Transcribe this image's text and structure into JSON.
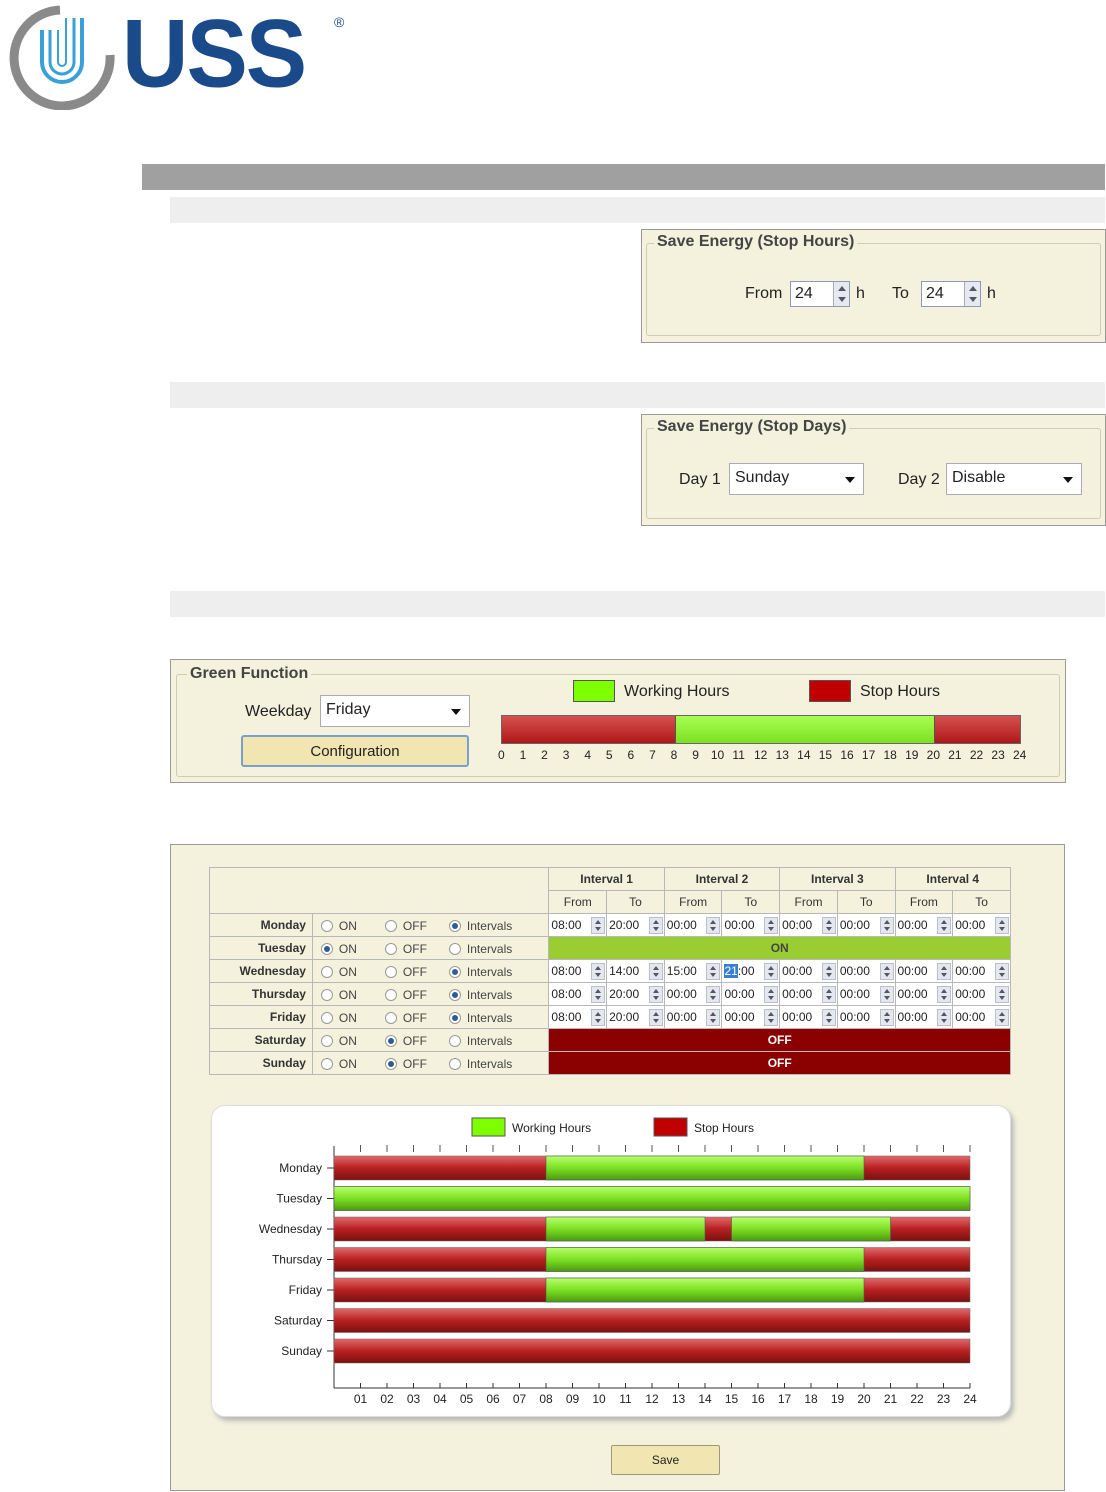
{
  "logo": {
    "text": "USS",
    "registered": "®"
  },
  "stop_hours": {
    "title": "Save Energy (Stop Hours)",
    "from_label": "From",
    "from_value": "24",
    "unit1": "h",
    "to_label": "To",
    "to_value": "24",
    "unit2": "h"
  },
  "stop_days": {
    "title": "Save Energy (Stop Days)",
    "day1_label": "Day 1",
    "day1_value": "Sunday",
    "day2_label": "Day 2",
    "day2_value": "Disable"
  },
  "green": {
    "title": "Green Function",
    "weekday_label": "Weekday",
    "weekday_value": "Friday",
    "config_button": "Configuration",
    "legend_working": "Working Hours",
    "legend_stop": "Stop Hours",
    "ticks": [
      "0",
      "1",
      "2",
      "3",
      "4",
      "5",
      "6",
      "7",
      "8",
      "9",
      "10",
      "11",
      "12",
      "13",
      "14",
      "15",
      "16",
      "17",
      "18",
      "19",
      "20",
      "21",
      "22",
      "23",
      "24"
    ],
    "segments": [
      {
        "from": 0,
        "to": 8,
        "state": "stop"
      },
      {
        "from": 8,
        "to": 20,
        "state": "work"
      },
      {
        "from": 20,
        "to": 24,
        "state": "stop"
      }
    ]
  },
  "schedule": {
    "interval_headers": [
      "Interval 1",
      "Interval 2",
      "Interval 3",
      "Interval 4"
    ],
    "from_label": "From",
    "to_label": "To",
    "opt_on": "ON",
    "opt_off": "OFF",
    "opt_intervals": "Intervals",
    "rows": [
      {
        "day": "Monday",
        "mode": "intervals",
        "times": [
          "08:00",
          "20:00",
          "00:00",
          "00:00",
          "00:00",
          "00:00",
          "00:00",
          "00:00"
        ]
      },
      {
        "day": "Tuesday",
        "mode": "on",
        "band": "ON"
      },
      {
        "day": "Wednesday",
        "mode": "intervals",
        "times": [
          "08:00",
          "14:00",
          "15:00",
          "21:00",
          "00:00",
          "00:00",
          "00:00",
          "00:00"
        ]
      },
      {
        "day": "Thursday",
        "mode": "intervals",
        "times": [
          "08:00",
          "20:00",
          "00:00",
          "00:00",
          "00:00",
          "00:00",
          "00:00",
          "00:00"
        ]
      },
      {
        "day": "Friday",
        "mode": "intervals",
        "times": [
          "08:00",
          "20:00",
          "00:00",
          "00:00",
          "00:00",
          "00:00",
          "00:00",
          "00:00"
        ]
      },
      {
        "day": "Saturday",
        "mode": "off",
        "band": "OFF"
      },
      {
        "day": "Sunday",
        "mode": "off",
        "band": "OFF"
      }
    ],
    "save_button": "Save"
  },
  "colors": {
    "work": "#7de023",
    "stop": "#c42020",
    "on_band": "#9acd32",
    "off_band": "#8b0000"
  },
  "chart_data": {
    "type": "bar",
    "legend": [
      "Working Hours",
      "Stop Hours"
    ],
    "categories": [
      "Monday",
      "Tuesday",
      "Wednesday",
      "Thursday",
      "Friday",
      "Saturday",
      "Sunday"
    ],
    "x_ticks": [
      "01",
      "02",
      "03",
      "04",
      "05",
      "06",
      "07",
      "08",
      "09",
      "10",
      "11",
      "12",
      "13",
      "14",
      "15",
      "16",
      "17",
      "18",
      "19",
      "20",
      "21",
      "22",
      "23",
      "24"
    ],
    "xlim": [
      0,
      24
    ],
    "working_intervals": {
      "Monday": [
        [
          8,
          20
        ]
      ],
      "Tuesday": [
        [
          0,
          24
        ]
      ],
      "Wednesday": [
        [
          8,
          14
        ],
        [
          15,
          21
        ]
      ],
      "Thursday": [
        [
          8,
          20
        ]
      ],
      "Friday": [
        [
          8,
          20
        ]
      ],
      "Saturday": [],
      "Sunday": []
    }
  }
}
